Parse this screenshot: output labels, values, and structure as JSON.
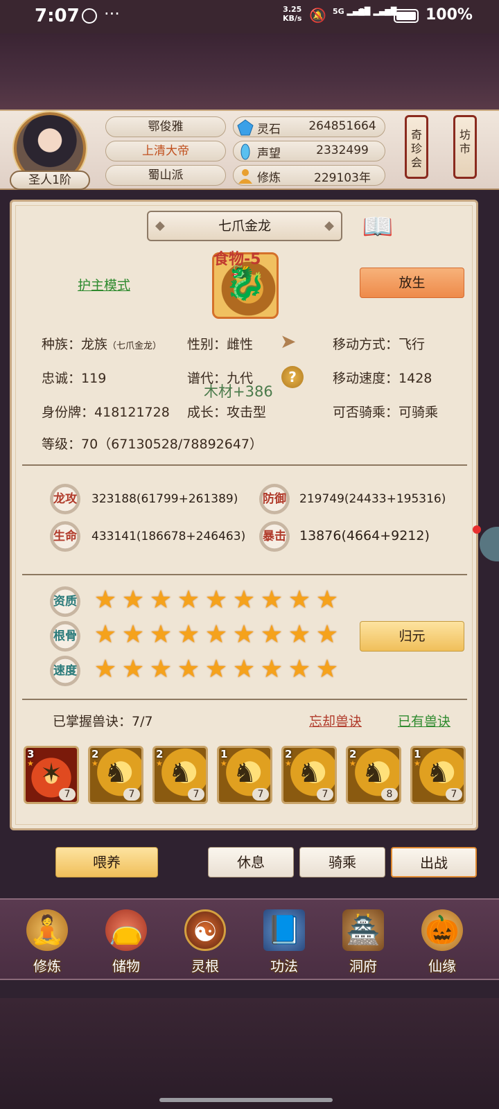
{
  "status_bar": {
    "time": "7:07",
    "speed": "3.25",
    "speed_unit": "KB/s",
    "sim1": "5G",
    "sim2": "5G",
    "battery": "100%"
  },
  "header": {
    "player_name": "鄂俊雅",
    "title": "上清大帝",
    "sect": "蜀山派",
    "rank": "圣人1阶",
    "resources": [
      {
        "icon": "spirit-stone-icon",
        "label": "灵石",
        "value": "264851664"
      },
      {
        "icon": "reputation-icon",
        "label": "声望",
        "value": "2332499"
      },
      {
        "icon": "cultivation-icon",
        "label": "修炼",
        "value": "229103年"
      }
    ],
    "lanterns": [
      "奇珍会",
      "坊市"
    ]
  },
  "pet": {
    "name": "七爪金龙",
    "guard_mode": "护主模式",
    "release": "放生",
    "food_change": "食物-5",
    "wood_change": "木材+386",
    "info": {
      "species_label": "种族：",
      "species_value": "龙族",
      "species_sub": "（七爪金龙）",
      "gender_label": "性别：",
      "gender_value": "雌性",
      "move_type_label": "移动方式：",
      "move_type_value": "飞行",
      "loyalty_label": "忠诚：",
      "loyalty_value": "119",
      "generation_label": "谱代：",
      "generation_value": "九代",
      "move_speed_label": "移动速度：",
      "move_speed_value": "1428",
      "id_label": "身份牌：",
      "id_value": "418121728",
      "growth_label": "成长：",
      "growth_value": "攻击型",
      "rideable_label": "可否骑乘：",
      "rideable_value": "可骑乘",
      "level_label": "等级：",
      "level_value": "70（67130528/78892647）"
    },
    "stats": [
      {
        "badge": "龙攻",
        "value": "323188(61799+261389)"
      },
      {
        "badge": "防御",
        "value": "219749(24433+195316)"
      },
      {
        "badge": "生命",
        "value": "433141(186678+246463)"
      },
      {
        "badge": "暴击",
        "value": "13876(4664+9212)"
      }
    ],
    "ratings": [
      {
        "label": "资质",
        "stars": 9
      },
      {
        "label": "根骨",
        "stars": 9
      },
      {
        "label": "速度",
        "stars": 9
      }
    ],
    "return_btn": "归元",
    "skills_mastered": "已掌握兽诀：7/7",
    "forget_skill": "忘却兽诀",
    "owned_skill": "已有兽诀",
    "skills": [
      {
        "level": "3",
        "count": "7"
      },
      {
        "level": "2",
        "count": "7"
      },
      {
        "level": "2",
        "count": "7"
      },
      {
        "level": "1",
        "count": "7"
      },
      {
        "level": "2",
        "count": "7"
      },
      {
        "level": "2",
        "count": "8"
      },
      {
        "level": "1",
        "count": "7"
      }
    ],
    "actions": {
      "feed": "喂养",
      "rest": "休息",
      "ride": "骑乘",
      "battle": "出战"
    }
  },
  "nav": [
    {
      "label": "修炼",
      "icon": "meditation-icon"
    },
    {
      "label": "储物",
      "icon": "storage-bag-icon"
    },
    {
      "label": "灵根",
      "icon": "spirit-root-icon"
    },
    {
      "label": "功法",
      "icon": "technique-book-icon"
    },
    {
      "label": "洞府",
      "icon": "cave-palace-icon"
    },
    {
      "label": "仙缘",
      "icon": "gourd-icon"
    }
  ],
  "colors": {
    "accent_green": "#2e8a2e",
    "accent_red": "#b03a2a",
    "star": "#f5a21c"
  }
}
